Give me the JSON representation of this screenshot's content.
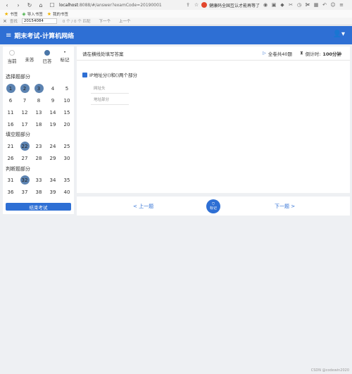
{
  "browser": {
    "url_host": "localhost",
    "url_path": ":8088/#/answer?examCode=20190001",
    "news_text": "健康码全国互认才能再等了"
  },
  "bookmarks": [
    {
      "label": "书签"
    },
    {
      "label": "导入书签"
    },
    {
      "label": "我的书签"
    }
  ],
  "findbar": {
    "close": "×",
    "label": "查找",
    "query": "20154084",
    "count": "0 个 / 0 个 匹配",
    "down": "下一个",
    "up": "上一个"
  },
  "app": {
    "title": "期末考试-计算机网络",
    "accent": "#2e6fd4"
  },
  "legend": {
    "current": "当前",
    "unanswered": "未答",
    "answered": "已答",
    "flagged": "标记",
    "flag_glyph": "•"
  },
  "sections": [
    {
      "title": "选择题部分",
      "questions": [
        {
          "n": "1",
          "answered": true
        },
        {
          "n": "2",
          "answered": true
        },
        {
          "n": "3",
          "answered": true
        },
        {
          "n": "4"
        },
        {
          "n": "5"
        },
        {
          "n": "6"
        },
        {
          "n": "7"
        },
        {
          "n": "8"
        },
        {
          "n": "9"
        },
        {
          "n": "10"
        },
        {
          "n": "11"
        },
        {
          "n": "12"
        },
        {
          "n": "13"
        },
        {
          "n": "14"
        },
        {
          "n": "15"
        },
        {
          "n": "16"
        },
        {
          "n": "17"
        },
        {
          "n": "18"
        },
        {
          "n": "19"
        },
        {
          "n": "20"
        }
      ]
    },
    {
      "title": "填空题部分",
      "questions": [
        {
          "n": "21"
        },
        {
          "n": "22",
          "answered": true
        },
        {
          "n": "23"
        },
        {
          "n": "24"
        },
        {
          "n": "25"
        },
        {
          "n": "26"
        },
        {
          "n": "27"
        },
        {
          "n": "28"
        },
        {
          "n": "29"
        },
        {
          "n": "30"
        }
      ]
    },
    {
      "title": "判断题部分",
      "questions": [
        {
          "n": "31"
        },
        {
          "n": "32",
          "answered": true
        },
        {
          "n": "33"
        },
        {
          "n": "34"
        },
        {
          "n": "35"
        },
        {
          "n": "36"
        },
        {
          "n": "37"
        },
        {
          "n": "38"
        },
        {
          "n": "39"
        },
        {
          "n": "40"
        }
      ]
    }
  ],
  "end_button": "结束考试",
  "header": {
    "hint": "请在横线处填写答案",
    "total": "全卷共40题",
    "timer_label": "倒计时:",
    "timer_value": "100分钟"
  },
  "question": {
    "title": "IP地址分()和()两个部分",
    "blanks": [
      "网址头",
      "地址部分"
    ]
  },
  "footer": {
    "prev": "< 上一题",
    "next": "下一题 >",
    "mark": "标记"
  },
  "watermark": "CSDN @codewin2020"
}
